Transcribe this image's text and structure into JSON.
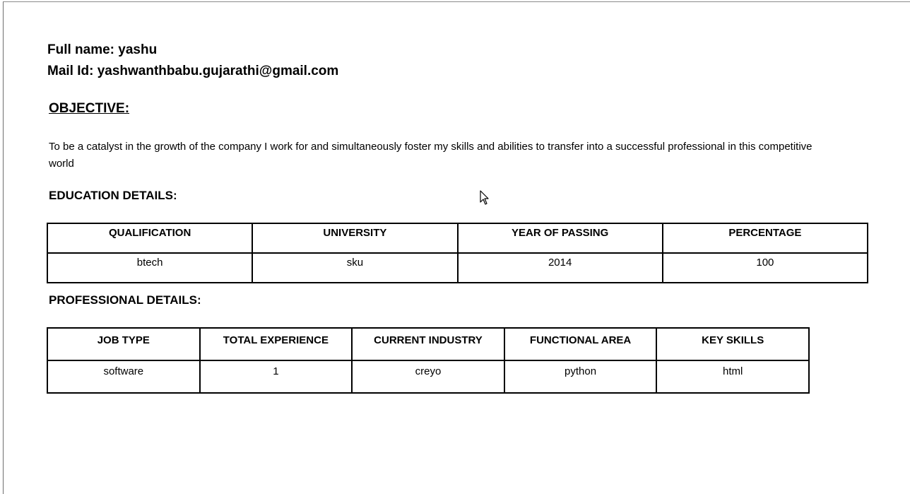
{
  "profile": {
    "full_name_line": "Full name: yashu",
    "mail_line": "Mail Id: yashwanthbabu.gujarathi@gmail.com"
  },
  "objective": {
    "heading": "OBJECTIVE:",
    "text": "To be a catalyst in the growth of the company I work for and simultaneously foster my skills and abilities to transfer into a successful professional in this competitive world"
  },
  "education": {
    "heading": "EDUCATION DETAILS:",
    "headers": [
      "QUALIFICATION",
      "UNIVERSITY",
      "YEAR OF PASSING",
      "PERCENTAGE"
    ],
    "rows": [
      [
        "btech",
        "sku",
        "2014",
        "100"
      ]
    ]
  },
  "professional": {
    "heading": "PROFESSIONAL DETAILS:",
    "headers": [
      "JOB TYPE",
      "TOTAL EXPERIENCE",
      "CURRENT INDUSTRY",
      "FUNCTIONAL AREA",
      "KEY SKILLS"
    ],
    "rows": [
      [
        "software",
        "1",
        "creyo",
        "python",
        "html"
      ]
    ]
  },
  "cursor": {
    "icon": "mouse-pointer-icon"
  }
}
